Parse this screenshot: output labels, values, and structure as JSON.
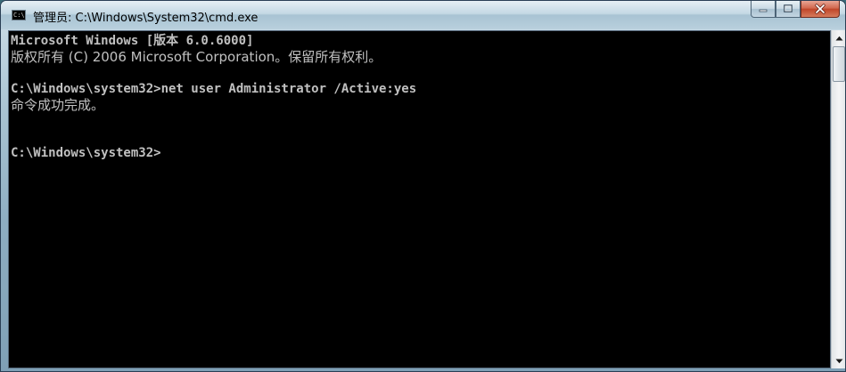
{
  "window": {
    "title": "管理员: C:\\Windows\\System32\\cmd.exe",
    "icon_label": "C:\\",
    "icon": "cmd-icon"
  },
  "caption_buttons": {
    "minimize_icon": "minimize-icon",
    "maximize_icon": "maximize-icon",
    "close_icon": "close-icon"
  },
  "console": {
    "lines": [
      "Microsoft Windows [版本 6.0.6000]",
      "版权所有 (C) 2006 Microsoft Corporation。保留所有权利。",
      "",
      "C:\\Windows\\system32>net user Administrator /Active:yes",
      "命令成功完成。",
      "",
      "",
      "C:\\Windows\\system32>"
    ],
    "text_color": "#c0c0c0",
    "background_color": "#000000"
  },
  "scrollbar": {
    "up_icon": "scroll-up-arrow-icon",
    "down_icon": "scroll-down-arrow-icon"
  }
}
